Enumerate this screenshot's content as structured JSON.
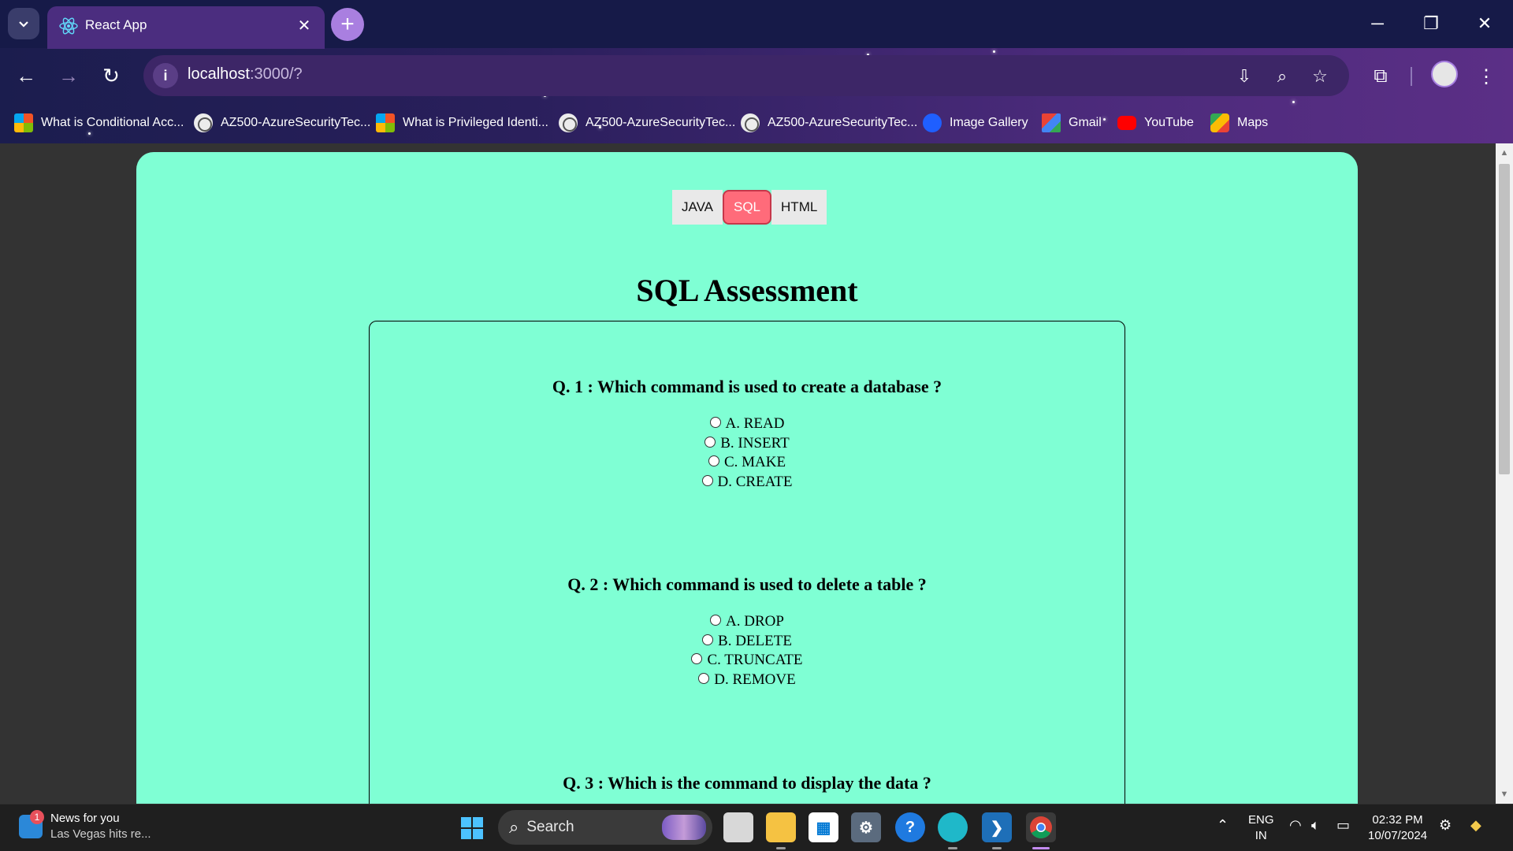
{
  "browser": {
    "tab_title": "React App",
    "url_host": "localhost",
    "url_path": ":3000/?",
    "bookmarks": [
      {
        "label": "What is Conditional Acc...",
        "icon": "microsoft-icon"
      },
      {
        "label": "AZ500-AzureSecurityTec...",
        "icon": "globe-icon"
      },
      {
        "label": "What is Privileged Identi...",
        "icon": "microsoft-icon"
      },
      {
        "label": "AZ500-AzureSecurityTec...",
        "icon": "globe-icon"
      },
      {
        "label": "AZ500-AzureSecurityTec...",
        "icon": "globe-icon"
      },
      {
        "label": "Image Gallery",
        "icon": "drop-icon"
      },
      {
        "label": "Gmail",
        "icon": "gmail-icon"
      },
      {
        "label": "YouTube",
        "icon": "youtube-icon"
      },
      {
        "label": "Maps",
        "icon": "maps-icon"
      }
    ]
  },
  "app": {
    "tabs": [
      {
        "label": "JAVA",
        "active": false
      },
      {
        "label": "SQL",
        "active": true
      },
      {
        "label": "HTML",
        "active": false
      }
    ],
    "title": "SQL Assessment",
    "questions": [
      {
        "text": "Q. 1 : Which command is used to create a database ?",
        "options": [
          "A. READ",
          "B. INSERT",
          "C. MAKE",
          "D. CREATE"
        ]
      },
      {
        "text": "Q. 2 : Which command is used to delete a table ?",
        "options": [
          "A. DROP",
          "B. DELETE",
          "C. TRUNCATE",
          "D. REMOVE"
        ]
      },
      {
        "text": "Q. 3 : Which is the command to display the data ?",
        "options": []
      }
    ],
    "colors": {
      "card_bg": "#7fffd4",
      "active_tab": "#ff6b7a"
    }
  },
  "taskbar": {
    "news_title": "News for you",
    "news_sub": "Las Vegas hits re...",
    "news_badge": "1",
    "search_label": "Search",
    "lang_top": "ENG",
    "lang_bottom": "IN",
    "time": "02:32 PM",
    "date": "10/07/2024"
  }
}
